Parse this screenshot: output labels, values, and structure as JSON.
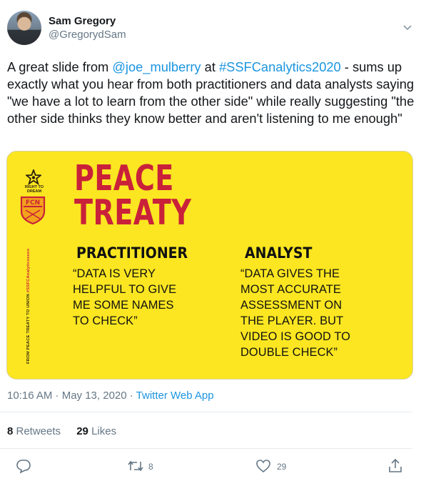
{
  "author": {
    "name": "Sam Gregory",
    "handle": "@GregorydSam"
  },
  "tweet": {
    "p1": "A great slide from ",
    "mention": "@joe_mulberry",
    "p2": " at ",
    "hashtag": "#SSFCanalytics2020",
    "p3": " - sums up exactly what you hear from both practitioners and data analysts saying \"we have a lot to learn from the other side\" while really suggesting \"the other side thinks they know better and aren't listening to me enough\""
  },
  "slide": {
    "logo_text": "RIGHT TO DREAM",
    "shield_text": "FCN",
    "vertical_prefix": "FROM PEACE TREATY TO UNION ",
    "vertical_hashtag": "#SSFCAnalyticsseoo",
    "title1": "PEACE",
    "title2": "TREATY",
    "left_heading": "PRACTITIONER",
    "left_lines": [
      "“DATA IS VERY",
      "HELPFUL TO GIVE",
      "ME SOME NAMES",
      "TO CHECK”"
    ],
    "right_heading": "ANALYST",
    "right_lines": [
      "“DATA GIVES THE",
      "MOST ACCURATE",
      "ASSESSMENT ON",
      "THE PLAYER. BUT",
      "VIDEO IS GOOD TO",
      "DOUBLE CHECK”"
    ]
  },
  "meta": {
    "timestamp": "10:16 AM · May 13, 2020 · ",
    "source": "Twitter Web App"
  },
  "stats": {
    "retweets": "8",
    "retweets_label": " Retweets",
    "likes": "29",
    "likes_label": " Likes"
  },
  "actions": {
    "retweet_count": "8",
    "like_count": "29"
  },
  "colors": {
    "link": "#1b95e0",
    "slide_bg": "#fbe621",
    "slide_red": "#c9213a"
  }
}
